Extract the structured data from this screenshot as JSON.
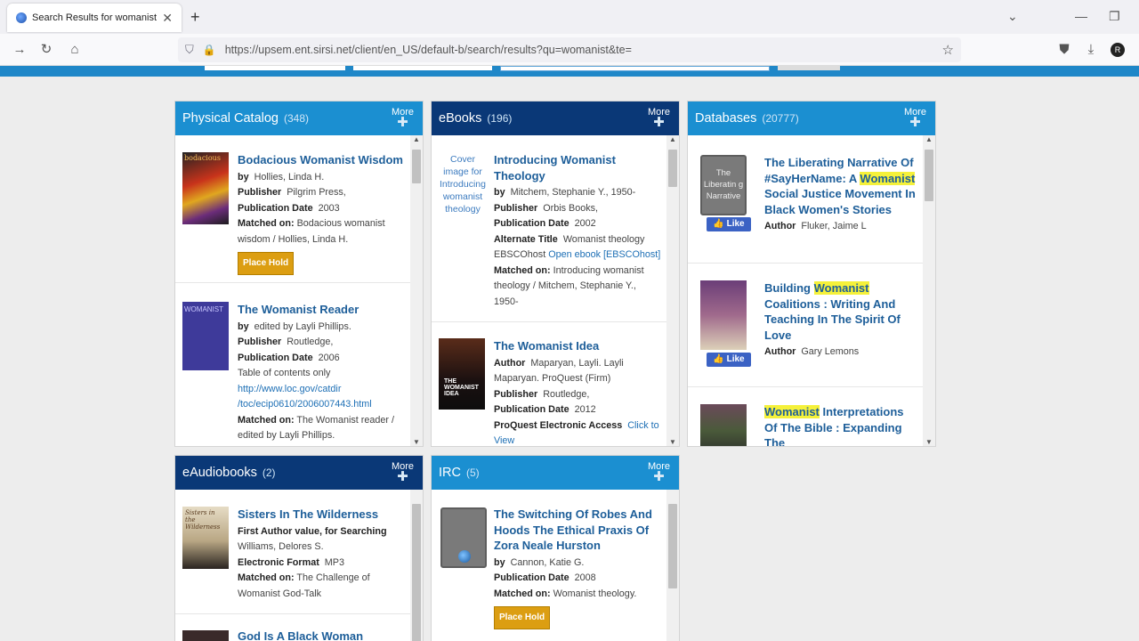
{
  "browser": {
    "tab_title": "Search Results for womanist",
    "url": "https://upsem.ent.sirsi.net/client/en_US/default-b/search/results?qu=womanist&te="
  },
  "colors": {
    "brand_blue": "#1b8fd1",
    "dark_blue": "#0a3877",
    "place_hold": "#dc9e12",
    "highlight": "#f5f13a"
  },
  "panels": {
    "physical": {
      "title": "Physical Catalog",
      "count": "(348)",
      "more": "More",
      "items": [
        {
          "title": "Bodacious Womanist Wisdom",
          "by_label": "by",
          "by": "Hollies, Linda H.",
          "pub_label": "Publisher",
          "pub": "Pilgrim Press,",
          "date_label": "Publication Date",
          "date": "2003",
          "match_label": "Matched on:",
          "match": "Bodacious womanist wisdom / Hollies, Linda H.",
          "hold": "Place Hold"
        },
        {
          "title": "The Womanist Reader",
          "by_label": "by",
          "by": "edited by Layli Phillips.",
          "pub_label": "Publisher",
          "pub": "Routledge,",
          "date_label": "Publication Date",
          "date": "2006",
          "toc": "Table of contents only",
          "link1": "http://www.loc.gov/catdir",
          "link2": "/toc/ecip0610/2006007443.html",
          "match_label": "Matched on:",
          "match": "The Womanist reader / edited by Layli Phillips."
        }
      ]
    },
    "ebooks": {
      "title": "eBooks",
      "count": "(196)",
      "more": "More",
      "items": [
        {
          "cover_alt": "Cover image for Introducing womanist theology",
          "title": "Introducing Womanist Theology",
          "by_label": "by",
          "by": "Mitchem, Stephanie Y., 1950-",
          "pub_label": "Publisher",
          "pub": "Orbis Books,",
          "date_label": "Publication Date",
          "date": "2002",
          "alt_label": "Alternate Title",
          "alt": "Womanist theology",
          "ebsco": "EBSCOhost",
          "ebsco_link": "Open ebook [EBSCOhost]",
          "match_label": "Matched on:",
          "match": "Introducing womanist theology / Mitchem, Stephanie Y., 1950-"
        },
        {
          "title": "The Womanist Idea",
          "author_label": "Author",
          "author": "Maparyan, Layli. Layli Maparyan. ProQuest (Firm)",
          "pub_label": "Publisher",
          "pub": "Routledge,",
          "date_label": "Publication Date",
          "date": "2012",
          "pq_label": "ProQuest Electronic Access",
          "pq_link": "Click to View"
        }
      ]
    },
    "databases": {
      "title": "Databases",
      "count": "(20777)",
      "more": "More",
      "like": "Like",
      "items": [
        {
          "title_a": "The Liberating Narrative Of #SayHerName: A ",
          "title_hl": "Womanist",
          "title_b": " Social Justice Movement In Black Women's Stories",
          "author_label": "Author",
          "author": "Fluker, Jaime L",
          "cover_text": "The Liberatin g Narrative"
        },
        {
          "title_a": "Building ",
          "title_hl": "Womanist",
          "title_b": " Coalitions : Writing And Teaching In The Spirit Of Love",
          "author_label": "Author",
          "author": "Gary Lemons"
        },
        {
          "title_hl": "Womanist",
          "title_b": " Interpretations Of The Bible : Expanding The"
        }
      ]
    },
    "eaudio": {
      "title": "eAudiobooks",
      "count": "(2)",
      "more": "More",
      "items": [
        {
          "title": "Sisters In The Wilderness",
          "first_label": "First Author value, for Searching",
          "first": "Williams, Delores S.",
          "fmt_label": "Electronic Format",
          "fmt": "MP3",
          "match_label": "Matched on:",
          "match": "The Challenge of Womanist God-Talk"
        },
        {
          "title": "God Is A Black Woman"
        }
      ]
    },
    "irc": {
      "title": "IRC",
      "count": "(5)",
      "more": "More",
      "items": [
        {
          "title": "The Switching Of Robes And Hoods The Ethical Praxis Of Zora Neale Hurston",
          "by_label": "by",
          "by": "Cannon, Katie G.",
          "date_label": "Publication Date",
          "date": "2008",
          "match_label": "Matched on:",
          "match": "Womanist theology.",
          "hold": "Place Hold"
        }
      ]
    }
  }
}
